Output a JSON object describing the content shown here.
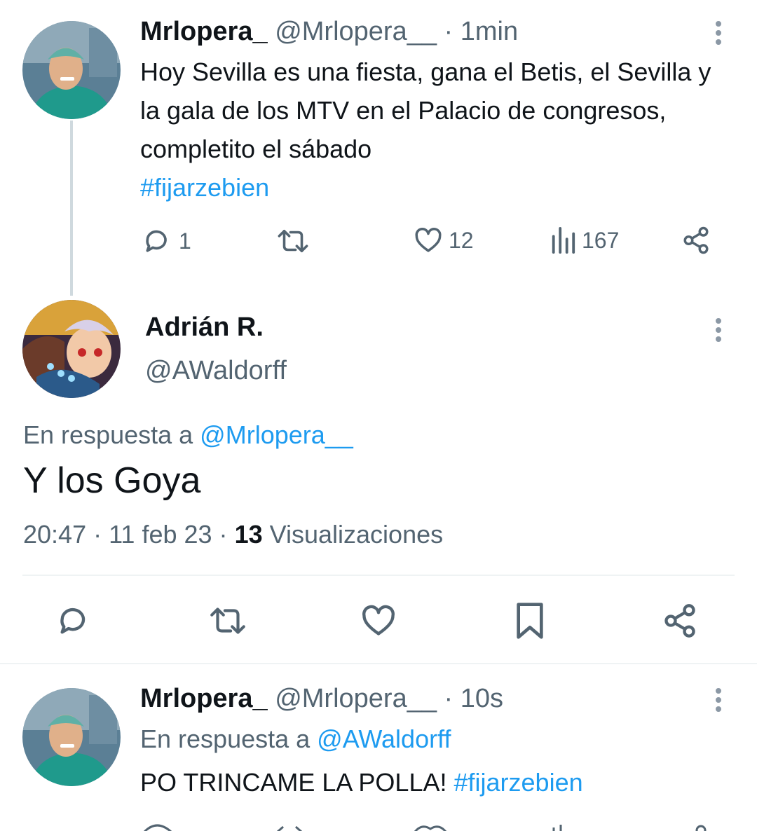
{
  "colors": {
    "accent": "#1d9bf0",
    "muted": "#536471",
    "text": "#0f1419",
    "thread_line": "#cfd9de"
  },
  "tweet1": {
    "name": "Mrlopera_",
    "handle": "@Mrlopera__",
    "time": "· 1min",
    "text": "Hoy Sevilla es una fiesta, gana el Betis, el Sevilla y la gala de los MTV en el Palacio de congresos, completito el sábado",
    "hashtag": "#fijarzebien",
    "actions": {
      "replies": "1",
      "likes": "12",
      "views": "167"
    }
  },
  "main_tweet": {
    "name": "Adrián R.",
    "handle": "@AWaldorff",
    "reply_prefix": "En respuesta a",
    "reply_to": "@Mrlopera__",
    "text": "Y los Goya",
    "time": "20:47 · 11 feb 23 ·",
    "views_count": "13",
    "views_label": "Visualizaciones"
  },
  "tweet3": {
    "name": "Mrlopera_",
    "handle": "@Mrlopera__",
    "time": "· 10s",
    "reply_prefix": "En respuesta a",
    "reply_to": "@AWaldorff",
    "text": "PO TRINCAME LA POLLA!",
    "hashtag": "#fijarzebien"
  },
  "icons": [
    "reply-icon",
    "retweet-icon",
    "like-icon",
    "views-icon",
    "share-icon",
    "bookmark-icon",
    "more-icon"
  ]
}
